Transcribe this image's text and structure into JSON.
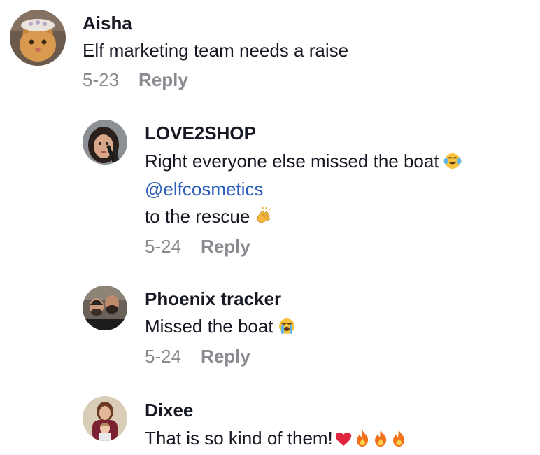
{
  "comments": [
    {
      "username": "Aisha",
      "lines": [
        "Elf marketing team needs a raise"
      ],
      "date": "5-23",
      "reply_label": "Reply",
      "avatar_icon": "cat-avatar"
    },
    {
      "username": "LOVE2SHOP",
      "line1": "Right everyone else missed the boat",
      "line1_emoji": "tears-of-joy-emoji",
      "mention": "@elfcosmetics",
      "line3": "to the rescue",
      "line3_emoji": "clapping-hands-emoji",
      "date": "5-24",
      "reply_label": "Reply",
      "avatar_icon": "woman-selfie-avatar"
    },
    {
      "username": "Phoenix tracker",
      "line1": "Missed the boat",
      "line1_emoji": "loudly-crying-emoji",
      "date": "5-24",
      "reply_label": "Reply",
      "avatar_icon": "two-men-avatar"
    },
    {
      "username": "Dixee",
      "line1": "That is so kind of them!",
      "line1_emojis": [
        "red-heart-emoji",
        "fire-emoji",
        "fire-emoji",
        "fire-emoji"
      ],
      "avatar_icon": "woman-and-child-avatar"
    }
  ],
  "colors": {
    "text": "#161823",
    "meta": "#8a8b91",
    "mention": "#2b5db9",
    "heart": "#e0243b",
    "fire": "#f2721c"
  }
}
